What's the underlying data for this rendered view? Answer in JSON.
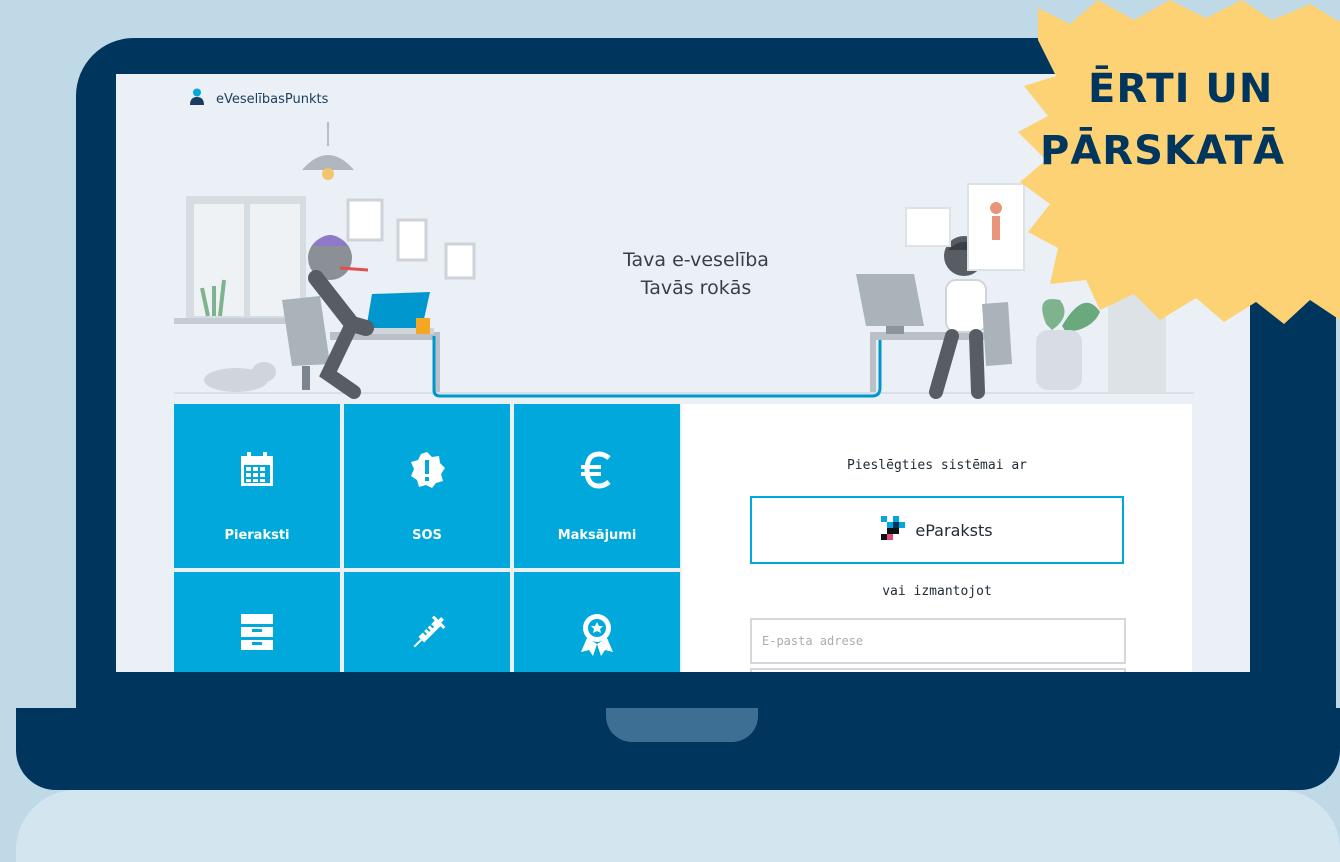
{
  "app": {
    "logo_text": "eVeselībasPunkts"
  },
  "hero": {
    "title_line1": "Tava e-veselība",
    "title_line2": "Tavās rokās"
  },
  "tiles": [
    {
      "label": "Pieraksti",
      "icon": "calendar-icon"
    },
    {
      "label": "SOS",
      "icon": "alert-icon"
    },
    {
      "label": "Maksājumi",
      "icon": "euro-icon"
    },
    {
      "label": "",
      "icon": "cabinet-icon"
    },
    {
      "label": "",
      "icon": "syringe-icon"
    },
    {
      "label": "",
      "icon": "award-icon"
    }
  ],
  "login": {
    "title": "Pieslēgties sistēmai ar",
    "eparaksts_label": "eParaksts",
    "or_text": "vai izmantojot",
    "email_placeholder": "E-pasta adrese"
  },
  "badge": {
    "line1": "ĒRTI UN",
    "line2": "PĀRSKATĀ"
  },
  "colors": {
    "background": "#bfd9e6",
    "laptop": "#00355d",
    "tile": "#00a8dc",
    "badge": "#fcd274",
    "badge_text": "#00355d"
  }
}
